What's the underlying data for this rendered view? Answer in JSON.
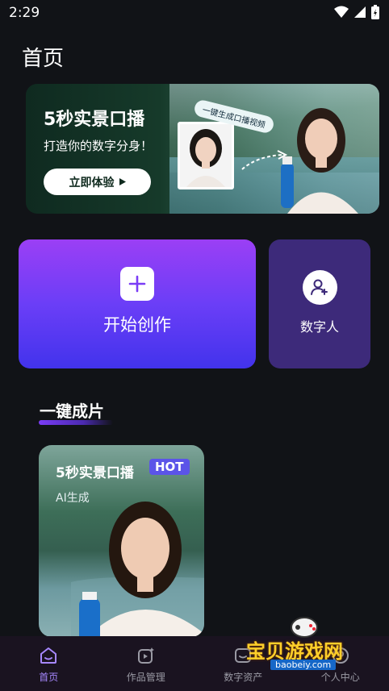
{
  "status_bar": {
    "time": "2:29"
  },
  "page": {
    "title": "首页"
  },
  "banner": {
    "title": "5秒实景口播",
    "subtitle": "打造你的数字分身！",
    "button_label": "立即体验",
    "tag": "一键生成口播视频"
  },
  "create_card": {
    "label": "开始创作"
  },
  "avatar_card": {
    "label": "数字人"
  },
  "section": {
    "title": "一键成片"
  },
  "video_card": {
    "title": "5秒实景口播",
    "badge": "HOT",
    "subtitle": "AI生成"
  },
  "nav": {
    "items": [
      {
        "label": "首页",
        "icon": "home-icon",
        "active": true
      },
      {
        "label": "作品管理",
        "icon": "video-manage-icon",
        "active": false
      },
      {
        "label": "数字资产",
        "icon": "asset-icon",
        "active": false
      },
      {
        "label": "个人中心",
        "icon": "profile-icon",
        "active": false
      }
    ]
  },
  "watermark": {
    "text": "宝贝游戏网",
    "url": "baobeiy.com"
  },
  "colors": {
    "accent": "#a788ff",
    "background": "#111317",
    "card_purple": "#6b3ef7"
  }
}
